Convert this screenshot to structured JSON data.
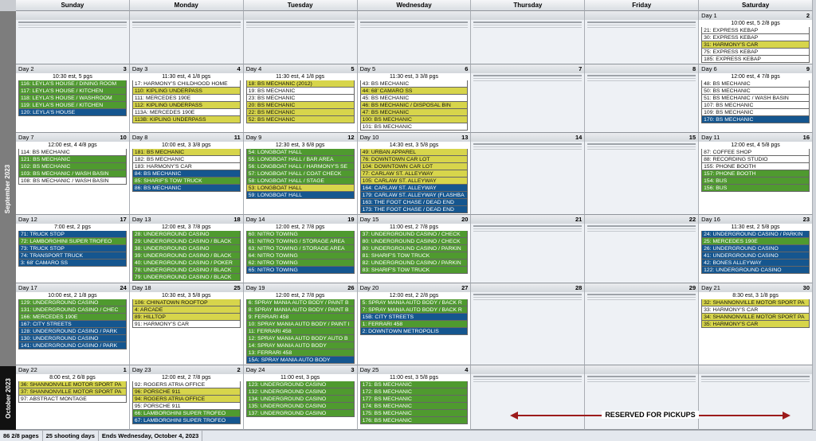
{
  "days_of_week": [
    "Sunday",
    "Monday",
    "Tuesday",
    "Wednesday",
    "Thursday",
    "Friday",
    "Saturday"
  ],
  "months": {
    "sep": "September 2023",
    "oct": "October 2023"
  },
  "colors": {
    "w": "#ffffff",
    "y": "#d7d54b",
    "g": "#4f9a2f",
    "b": "#15568f"
  },
  "weeks": [
    [
      {
        "empty": true,
        "num": ""
      },
      {
        "empty": true,
        "num": ""
      },
      {
        "empty": true,
        "num": ""
      },
      {
        "empty": true,
        "num": ""
      },
      {
        "empty": true,
        "num": ""
      },
      {
        "empty": true,
        "num": ""
      },
      {
        "label": "Day 1",
        "num": "2",
        "summary": "10:00 est, 5 2/8 pgs",
        "entries": [
          [
            "21: EXPRESS KEBAP",
            "w"
          ],
          [
            "30: EXPRESS KEBAP",
            "w"
          ],
          [
            "31: HARMONY'S CAR",
            "y"
          ],
          [
            "75: EXPRESS KEBAP",
            "w"
          ],
          [
            "185: EXPRESS KEBAP",
            "w"
          ]
        ]
      }
    ],
    [
      {
        "label": "Day 2",
        "num": "3",
        "summary": "10:30 est, 5 pgs",
        "entries": [
          [
            "116: LEYLA'S HOUSE / DINING ROOM",
            "g"
          ],
          [
            "117: LEYLA'S HOUSE / KITCHEN",
            "g"
          ],
          [
            "118: LEYLA'S HOUSE / WASHROOM",
            "g"
          ],
          [
            "119: LEYLA'S HOUSE / KITCHEN",
            "g"
          ],
          [
            "120: LEYLA'S HOUSE",
            "b"
          ]
        ]
      },
      {
        "label": "Day 3",
        "num": "4",
        "summary": "11:30 est, 4 1/8 pgs",
        "entries": [
          [
            "17: HARMONY'S CHILDHOOD HOME",
            "w"
          ],
          [
            "110: KIPLING UNDERPASS",
            "y"
          ],
          [
            "111: MERCEDES 190E",
            "w"
          ],
          [
            "112: KIPLING UNDERPASS",
            "y"
          ],
          [
            "113A: MERCEDES 190E",
            "w"
          ],
          [
            "113B: KIPLING UNDERPASS",
            "y"
          ]
        ]
      },
      {
        "label": "Day 4",
        "num": "5",
        "summary": "11:30 est, 4 1/8 pgs",
        "entries": [
          [
            "18: BS MECHANIC (2012)",
            "y"
          ],
          [
            "19: BS MECHANIC",
            "w"
          ],
          [
            "23: BS MECHANIC",
            "w"
          ],
          [
            "20: BS MECHANIC",
            "y"
          ],
          [
            "22: BS MECHANIC",
            "y"
          ],
          [
            "52: BS MECHANIC",
            "y"
          ]
        ]
      },
      {
        "label": "Day 5",
        "num": "6",
        "summary": "11:30 est, 3 3/8 pgs",
        "entries": [
          [
            "43: BS MECHANIC",
            "w"
          ],
          [
            "44: 68' CAMARO SS",
            "y"
          ],
          [
            "45: BS MECHANIC",
            "w"
          ],
          [
            "46: BS MECHANIC / DISPOSAL BIN",
            "y"
          ],
          [
            "47: BS MECHANIC",
            "y"
          ],
          [
            "100: BS MECHANIC",
            "y"
          ],
          [
            "101: BS MECHANIC",
            "w"
          ]
        ]
      },
      {
        "empty": true,
        "num": "7"
      },
      {
        "empty": true,
        "num": "8"
      },
      {
        "label": "Day 6",
        "num": "9",
        "summary": "12:00 est, 4 7/8 pgs",
        "entries": [
          [
            "48: BS MECHANIC",
            "w"
          ],
          [
            "50: BS MECHANIC",
            "w"
          ],
          [
            "51: BS MECHANIC / WASH BASIN",
            "w"
          ],
          [
            "107: BS MECHANIC",
            "w"
          ],
          [
            "109: BS MECHANIC",
            "w"
          ],
          [
            "170: BS MECHANIC",
            "b"
          ]
        ]
      }
    ],
    [
      {
        "label": "Day 7",
        "num": "10",
        "summary": "12:00 est, 4 4/8 pgs",
        "entries": [
          [
            "114: BS MECHANIC",
            "w"
          ],
          [
            "121: BS MECHANIC",
            "g"
          ],
          [
            "102: BS MECHANIC",
            "g"
          ],
          [
            "103: BS MECHANIC / WASH BASIN",
            "g"
          ],
          [
            "108: BS MECHANIC / WASH BASIN",
            "w"
          ]
        ]
      },
      {
        "label": "Day 8",
        "num": "11",
        "summary": "10:00 est, 3 3/8 pgs",
        "entries": [
          [
            "181: BS MECHANIC",
            "y"
          ],
          [
            "182: BS MECHANIC",
            "w"
          ],
          [
            "183: HARMONY'S CAR",
            "w"
          ],
          [
            "84: BS MECHANIC",
            "b"
          ],
          [
            "85: SHARIF'S TOW TRUCK",
            "g"
          ],
          [
            "86: BS MECHANIC",
            "b"
          ]
        ]
      },
      {
        "label": "Day 9",
        "num": "12",
        "summary": "12:30 est, 3 6/8 pgs",
        "entries": [
          [
            "54: LONGBOAT HALL",
            "g"
          ],
          [
            "55: LONGBOAT HALL / BAR AREA",
            "g"
          ],
          [
            "56: LONGBOAT HALL / HARMONY'S SE",
            "g"
          ],
          [
            "57: LONGBOAT HALL / COAT CHECK",
            "g"
          ],
          [
            "58: LONGBOAT HALL / STAGE",
            "g"
          ],
          [
            "53: LONGBOAT HALL",
            "y"
          ],
          [
            "59: LONGBOAT HALL",
            "b"
          ]
        ]
      },
      {
        "label": "Day 10",
        "num": "13",
        "summary": "14:30 est, 3 5/8 pgs",
        "entries": [
          [
            "49: URBAN APPAREL",
            "y"
          ],
          [
            "76: DOWNTOWN CAR LOT",
            "y"
          ],
          [
            "104: DOWNTOWN CAR LOT",
            "y"
          ],
          [
            "77: CARLAW ST. ALLEYWAY",
            "y"
          ],
          [
            "105: CARLAW ST. ALLEYWAY",
            "y"
          ],
          [
            "164: CARLAW ST. ALLEYWAY",
            "b"
          ],
          [
            "179: CARLAW ST. ALLEYWAY (FLASHBA",
            "b"
          ],
          [
            "163: THE FOOT CHASE / DEAD END",
            "b"
          ],
          [
            "173: THE FOOT CHASE / DEAD END",
            "b"
          ]
        ]
      },
      {
        "empty": true,
        "num": "14"
      },
      {
        "empty": true,
        "num": "15"
      },
      {
        "label": "Day 11",
        "num": "16",
        "summary": "12:00 est, 4 5/8 pgs",
        "entries": [
          [
            "87: COFFEE SHOP",
            "w"
          ],
          [
            "88: RECORDING STUDIO",
            "w"
          ],
          [
            "155: PHONE BOOTH",
            "w"
          ],
          [
            "157: PHONE BOOTH",
            "g"
          ],
          [
            "154: BUS",
            "g"
          ],
          [
            "156: BUS",
            "g"
          ]
        ]
      }
    ],
    [
      {
        "label": "Day 12",
        "num": "17",
        "summary": "7:00 est, 2 pgs",
        "entries": [
          [
            "71: TRUCK STOP",
            "b"
          ],
          [
            "72: LAMBORGHINI SUPER TROFEO",
            "g"
          ],
          [
            "73: TRUCK STOP",
            "b"
          ],
          [
            "74: TRANSPORT TRUCK",
            "b"
          ],
          [
            "3: 68' CAMARO SS",
            "b"
          ]
        ]
      },
      {
        "label": "Day 13",
        "num": "18",
        "summary": "12:00 est, 3 7/8 pgs",
        "entries": [
          [
            "28: UNDERGROUND CASINO",
            "g"
          ],
          [
            "29: UNDERGROUND CASINO / BLACK",
            "g"
          ],
          [
            "38: UNDERGROUND CASINO",
            "g"
          ],
          [
            "39: UNDERGROUND CASINO / BLACK",
            "g"
          ],
          [
            "40: UNDERGROUND CASINO / POKER",
            "g"
          ],
          [
            "78: UNDERGROUND CASINO / BLACK",
            "g"
          ],
          [
            "79: UNDERGROUND CASINO / BLACK",
            "g"
          ]
        ]
      },
      {
        "label": "Day 14",
        "num": "19",
        "summary": "12:00 est, 2 7/8 pgs",
        "entries": [
          [
            "60: NITRO TOWING",
            "g"
          ],
          [
            "61: NITRO TOWING / STORAGE AREA",
            "g"
          ],
          [
            "63: NITRO TOWING / STORAGE AREA",
            "g"
          ],
          [
            "64: NITRO TOWING",
            "g"
          ],
          [
            "62: NITRO TOWING",
            "g"
          ],
          [
            "65: NITRO TOWING",
            "b"
          ]
        ]
      },
      {
        "label": "Day 15",
        "num": "20",
        "summary": "11:00 est, 2 7/8 pgs",
        "entries": [
          [
            "37: UNDERGROUND CASINO / CHECK",
            "g"
          ],
          [
            "80: UNDERGROUND CASINO / CHECK",
            "g"
          ],
          [
            "80: UNDERGROUND CASINO / PARKIN",
            "g"
          ],
          [
            "81: SHARIF'S TOW TRUCK",
            "g"
          ],
          [
            "82: UNDERGROUND CASINO / PARKIN",
            "g"
          ],
          [
            "83: SHARIF'S TOW TRUCK",
            "g"
          ]
        ]
      },
      {
        "empty": true,
        "num": "21"
      },
      {
        "empty": true,
        "num": "22"
      },
      {
        "label": "Day 16",
        "num": "23",
        "summary": "11:30 est, 2 5/8 pgs",
        "entries": [
          [
            "24: UNDERGROUND CASINO / PARKIN",
            "b"
          ],
          [
            "25: MERCEDES 190E",
            "g"
          ],
          [
            "26: UNDERGROUND CASINO",
            "b"
          ],
          [
            "41: UNDERGROUND CASINO",
            "b"
          ],
          [
            "42: BONES ALLEYWAY",
            "b"
          ],
          [
            "122: UNDERGROUND CASINO",
            "b"
          ]
        ]
      }
    ],
    [
      {
        "label": "Day 17",
        "num": "24",
        "summary": "10:00 est, 2 1/8 pgs",
        "entries": [
          [
            "129: UNDERGROUND CASINO",
            "g"
          ],
          [
            "131: UNDERGROUND CASINO / CHEC",
            "g"
          ],
          [
            "166: MERCEDES 190E",
            "g"
          ],
          [
            "167: CITY STREETS",
            "b"
          ],
          [
            "128: UNDERGROUND CASINO / PARK",
            "b"
          ],
          [
            "130: UNDERGROUND CASINO",
            "b"
          ],
          [
            "141: UNDERGROUND CASINO / PARK",
            "b"
          ]
        ]
      },
      {
        "label": "Day 18",
        "num": "25",
        "summary": "10:30 est, 3 5/8 pgs",
        "entries": [
          [
            "106: CHINATOWN ROOFTOP",
            "y"
          ],
          [
            "4: ARCADE",
            "y"
          ],
          [
            "89: HILLTOP",
            "y"
          ],
          [
            "91: HARMONY'S CAR",
            "w"
          ]
        ]
      },
      {
        "label": "Day 19",
        "num": "26",
        "summary": "12:00 est, 2 7/8 pgs",
        "entries": [
          [
            "6: SPRAY MANIA AUTO BODY / PAINT B",
            "g"
          ],
          [
            "8: SPRAY MANIA AUTO BODY / PAINT B",
            "g"
          ],
          [
            "9: FERRARI 458",
            "g"
          ],
          [
            "10: SPRAY MANIA AUTO BODY / PAINT I",
            "g"
          ],
          [
            "11: FERRARI 458",
            "g"
          ],
          [
            "12: SPRAY MANIA AUTO BODY AUTO B",
            "g"
          ],
          [
            "14: SPRAY MANIA AUTO BODY",
            "g"
          ],
          [
            "13: FERRARI 458",
            "g"
          ],
          [
            "15A: SPRAY MANIA AUTO BODY",
            "b"
          ]
        ]
      },
      {
        "label": "Day 20",
        "num": "27",
        "summary": "12:00 est, 2 2/8 pgs",
        "entries": [
          [
            "5: SPRAY MANIA AUTO BODY / BACK R",
            "g"
          ],
          [
            "7: SPRAY MANIA AUTO BODY / BACK R",
            "g"
          ],
          [
            "15B: CITY STREETS",
            "b"
          ],
          [
            "1: FERRARI 458",
            "g"
          ],
          [
            "2: DOWNTOWN METROPOLIS",
            "b"
          ]
        ]
      },
      {
        "empty": true,
        "num": "28"
      },
      {
        "empty": true,
        "num": "29"
      },
      {
        "label": "Day 21",
        "num": "30",
        "summary": "8:30 est, 3 1/8 pgs",
        "entries": [
          [
            "32: SHANNONVILLE MOTOR SPORT PA",
            "y"
          ],
          [
            "33: HARMONY'S CAR",
            "w"
          ],
          [
            "34: SHANNONVILLE MOTOR SPORT PA",
            "y"
          ],
          [
            "35: HARMONY'S CAR",
            "y"
          ]
        ]
      }
    ],
    [
      {
        "label": "Day 22",
        "num": "1",
        "summary": "8:00 est, 2 6/8 pgs",
        "entries": [
          [
            "36: SHANNONVILLE MOTOR SPORT PA",
            "y"
          ],
          [
            "37: SHANNONVILLE MOTOR SPORT PA",
            "y"
          ],
          [
            "97: ABSTRACT MONTAGE",
            "w"
          ]
        ]
      },
      {
        "label": "Day 23",
        "num": "2",
        "summary": "12:00 est, 2 7/8 pgs",
        "entries": [
          [
            "92: ROGERS ATRIA OFFICE",
            "w"
          ],
          [
            "96: PORSCHE 911",
            "y"
          ],
          [
            "94: ROGERS ATRIA OFFICE",
            "y"
          ],
          [
            "95: PORSCHE 911",
            "w"
          ],
          [
            "66: LAMBORGHINI SUPER TROFEO",
            "g"
          ],
          [
            "67: LAMBORGHINI SUPER TROFEO",
            "b"
          ]
        ]
      },
      {
        "label": "Day 24",
        "num": "3",
        "summary": "11:00 est, 3 pgs",
        "entries": [
          [
            "123: UNDERGROUND CASINO",
            "g"
          ],
          [
            "132: UNDERGROUND CASINO",
            "g"
          ],
          [
            "134: UNDERGROUND CASINO",
            "g"
          ],
          [
            "135: UNDERGROUND CASINO",
            "g"
          ],
          [
            "137: UNDERGROUND CASINO",
            "g"
          ]
        ]
      },
      {
        "label": "Day 25",
        "num": "4",
        "summary": "11:00 est, 3 5/8 pgs",
        "entries": [
          [
            "171: BS MECHANIC",
            "g"
          ],
          [
            "172: BS MECHANIC",
            "g"
          ],
          [
            "177: BS MECHANIC",
            "g"
          ],
          [
            "174: BS MECHANIC",
            "g"
          ],
          [
            "175: BS MECHANIC",
            "g"
          ],
          [
            "176: BS MECHANIC",
            "g"
          ]
        ]
      },
      {
        "empty": true,
        "num": ""
      },
      {
        "empty": true,
        "num": ""
      },
      {
        "empty": true,
        "num": ""
      }
    ]
  ],
  "reserved_text": "RESERVED FOR PICKUPS",
  "status": {
    "pages": "86 2/8 pages",
    "days": "25 shooting days",
    "ends": "Ends Wednesday, October 4, 2023"
  }
}
